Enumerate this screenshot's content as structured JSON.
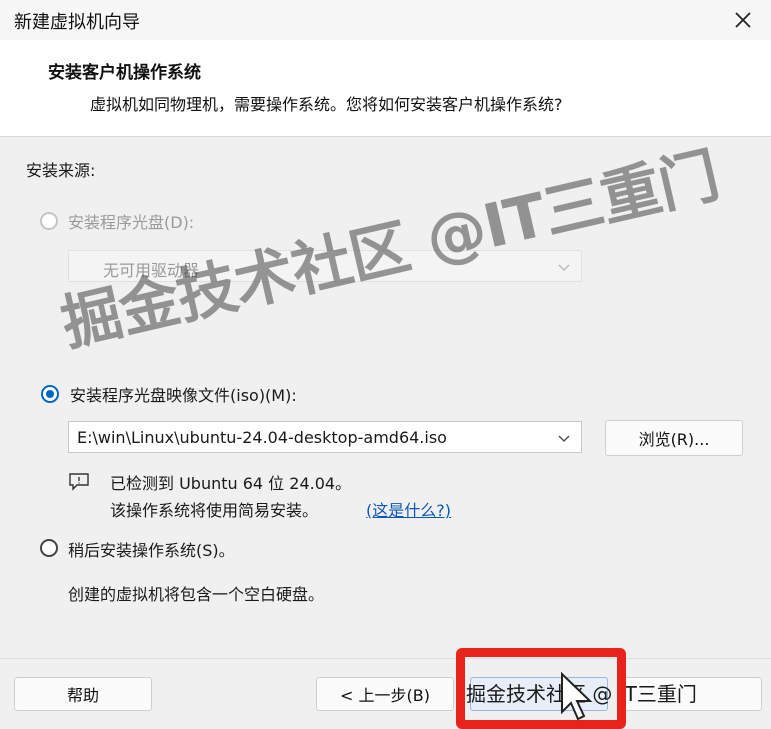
{
  "window": {
    "title": "新建虚拟机向导"
  },
  "header": {
    "title": "安装客户机操作系统",
    "subtitle": "虚拟机如同物理机，需要操作系统。您将如何安装客户机操作系统?"
  },
  "source": {
    "label": "安装来源:",
    "disc_option": {
      "label": "安装程序光盘(D):",
      "checked": false,
      "enabled": false
    },
    "disc_drive": {
      "value": "无可用驱动器"
    },
    "iso_option": {
      "label": "安装程序光盘映像文件(iso)(M):",
      "checked": true
    },
    "iso_path": {
      "value": "E:\\win\\Linux\\ubuntu-24.04-desktop-amd64.iso"
    },
    "browse_label": "浏览(R)...",
    "detected_line1": "已检测到 Ubuntu 64 位 24.04。",
    "detected_line2": "该操作系统将使用简易安装。",
    "whats_this": "(这是什么?)",
    "later_option": {
      "label": "稍后安装操作系统(S)。",
      "checked": false
    },
    "later_note": "创建的虚拟机将包含一个空白硬盘。"
  },
  "footer": {
    "help_label": "帮助",
    "back_label": "< 上一步(B)"
  },
  "overlay": {
    "watermark": "掘金技术社区 @IT三重门",
    "footer_watermark": "掘金技术社区 @ IT三重门",
    "highlight_color": "#e8231c"
  },
  "colors": {
    "accent": "#0067c0",
    "link": "#0b57b5"
  }
}
